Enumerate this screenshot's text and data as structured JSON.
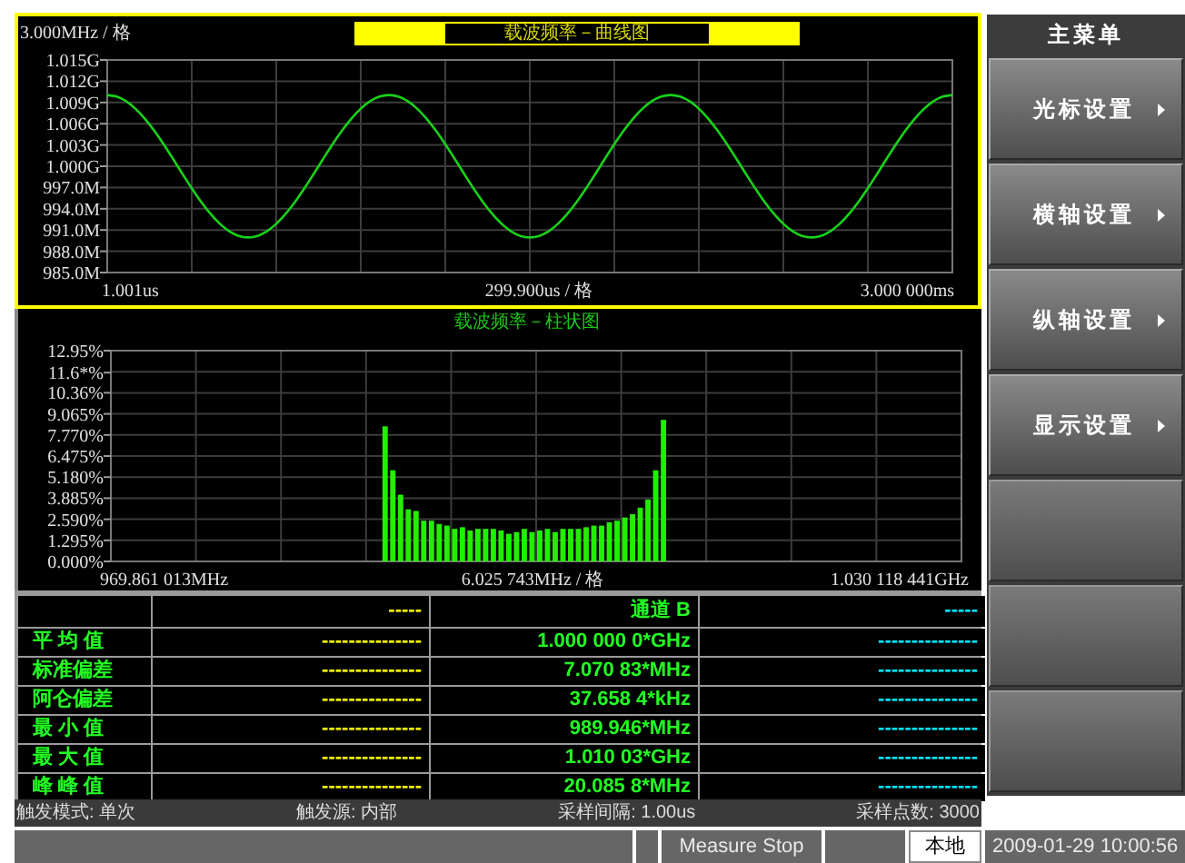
{
  "line_chart": {
    "y_scale": "3.000MHz / 格",
    "title": "载波频率－曲线图",
    "y_labels": [
      "1.015G",
      "1.012G",
      "1.009G",
      "1.006G",
      "1.003G",
      "1.000G",
      "997.0M",
      "994.0M",
      "991.0M",
      "988.0M",
      "985.0M"
    ],
    "x_start": "1.001us",
    "x_scale": "299.900us / 格",
    "x_end": "3.000 000ms"
  },
  "histogram": {
    "chart_data": {
      "type": "bar",
      "title": "载波频率－柱状图",
      "xlabel": "6.025 743MHz / 格",
      "grid": true,
      "ylim": [
        0,
        12.95
      ],
      "yticks": [
        {
          "value": 0,
          "label": "0.000%"
        },
        {
          "value": 1.295,
          "label": "1.295%"
        },
        {
          "value": 2.59,
          "label": "2.590%"
        },
        {
          "value": 3.885,
          "label": "3.885%"
        },
        {
          "value": 5.18,
          "label": "5.180%"
        },
        {
          "value": 6.475,
          "label": "6.475%"
        },
        {
          "value": 7.77,
          "label": "7.770%"
        },
        {
          "value": 9.065,
          "label": "9.065%"
        },
        {
          "value": 10.36,
          "label": "10.36%"
        },
        {
          "value": 11.6,
          "label": "11.6*%"
        },
        {
          "value": 12.95,
          "label": "12.95%"
        }
      ],
      "categories": [
        null,
        null,
        null,
        null,
        null,
        null,
        null,
        null,
        null,
        null,
        null,
        null,
        null,
        null,
        null,
        null,
        null,
        null,
        null,
        null,
        null,
        null,
        null,
        null,
        null,
        null,
        null,
        null,
        null,
        null,
        null,
        null,
        null,
        null,
        null,
        null,
        null,
        null,
        null,
        null,
        null,
        null,
        null,
        null,
        null,
        null,
        null,
        null,
        null,
        null,
        null,
        null,
        null,
        null,
        null,
        null,
        null,
        null,
        null,
        null,
        null,
        null,
        null,
        null,
        null,
        null,
        null,
        null,
        null,
        null,
        null,
        null,
        null,
        null,
        null,
        null,
        null,
        null,
        null,
        null,
        null,
        null,
        null,
        null,
        null,
        null,
        null,
        null,
        null,
        null,
        null,
        null,
        null,
        null,
        null,
        null,
        null,
        null,
        null,
        null,
        null,
        null,
        null,
        null,
        null,
        null,
        null,
        null,
        null,
        null
      ],
      "series": [
        {
          "color": "#22ee00",
          "values": [
            null,
            null,
            null,
            null,
            null,
            null,
            null,
            null,
            null,
            null,
            null,
            null,
            null,
            null,
            null,
            null,
            null,
            null,
            null,
            null,
            null,
            null,
            null,
            null,
            null,
            null,
            null,
            null,
            null,
            null,
            null,
            null,
            null,
            null,
            null,
            8.3,
            5.6,
            4.1,
            3.2,
            3.1,
            2.5,
            2.5,
            2.3,
            2.2,
            2.0,
            2.1,
            1.9,
            2.0,
            2.0,
            2.0,
            1.9,
            1.7,
            1.8,
            2.0,
            1.8,
            1.9,
            2.0,
            1.8,
            2.0,
            2.0,
            2.0,
            2.1,
            2.2,
            2.2,
            2.4,
            2.5,
            2.7,
            2.9,
            3.3,
            3.8,
            5.6,
            8.7,
            null,
            null,
            null,
            null,
            null,
            null,
            null,
            null,
            null,
            null,
            null,
            null,
            null,
            null,
            null,
            null,
            null,
            null,
            null,
            null,
            null,
            null,
            null,
            null,
            null,
            null,
            null,
            null,
            null,
            null,
            null,
            null,
            null,
            null,
            null,
            null,
            null,
            null
          ]
        }
      ]
    },
    "x_start_label": "969.861 013MHz",
    "x_end_label": "1.030 118 441GHz"
  },
  "table": {
    "header": [
      "-----",
      "通道 B",
      "-----"
    ],
    "rows": [
      {
        "label": "平 均 值",
        "cells": [
          "---------------",
          "1.000 000 0*GHz",
          "---------------"
        ]
      },
      {
        "label": "标准偏差",
        "cells": [
          "---------------",
          "7.070 83*MHz",
          "---------------"
        ]
      },
      {
        "label": "阿仑偏差",
        "cells": [
          "---------------",
          "37.658 4*kHz",
          "---------------"
        ]
      },
      {
        "label": "最 小 值",
        "cells": [
          "---------------",
          "989.946*MHz",
          "---------------"
        ]
      },
      {
        "label": "最 大 值",
        "cells": [
          "---------------",
          "1.010 03*GHz",
          "---------------"
        ]
      },
      {
        "label": "峰 峰 值",
        "cells": [
          "---------------",
          "20.085 8*MHz",
          "---------------"
        ]
      }
    ]
  },
  "status_line": [
    "触发模式: 单次",
    "触发源: 内部",
    "采样间隔: 1.00us",
    "采样点数: 3000"
  ],
  "menu": {
    "title": "主菜单",
    "items": [
      {
        "kind": "submenu",
        "label": "光标设置"
      },
      {
        "kind": "submenu",
        "label": "横轴设置"
      },
      {
        "kind": "submenu",
        "label": "纵轴设置"
      },
      {
        "kind": "submenu",
        "label": "显示设置"
      },
      {
        "kind": "blank"
      },
      {
        "kind": "blank"
      },
      {
        "kind": "blank"
      }
    ]
  },
  "bottom_bar": {
    "message": "Measure Stop",
    "mode": "本地",
    "datetime": "2009-01-29 10:00:56"
  }
}
